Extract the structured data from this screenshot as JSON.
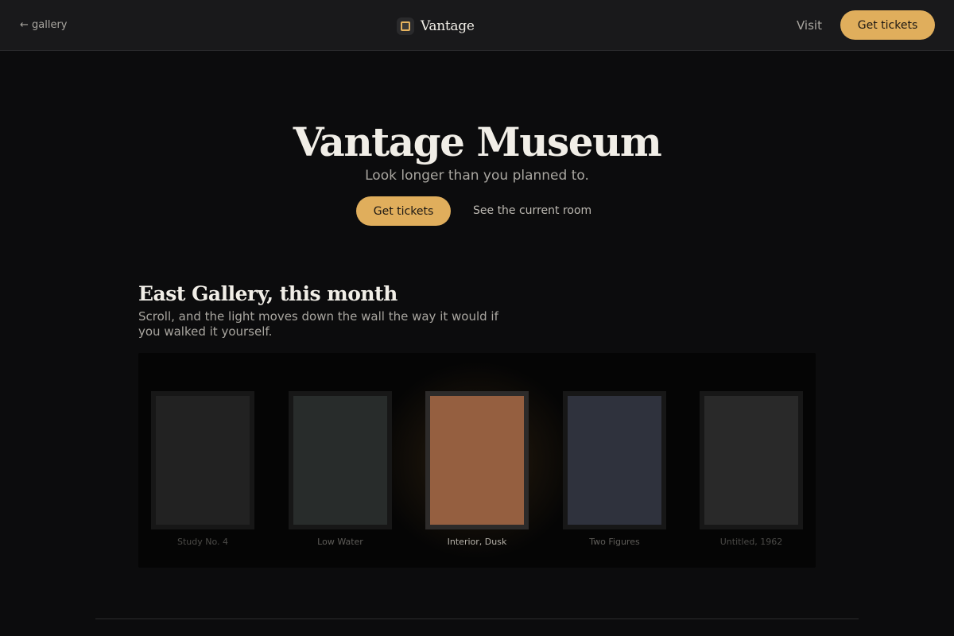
{
  "header": {
    "back_label": "← gallery",
    "brand": "Vantage",
    "brand_icon": "framed-painting-icon",
    "nav_visit": "Visit",
    "tickets_label": "Get tickets"
  },
  "hero": {
    "title": "Vantage Museum",
    "subtitle": "Look longer than you planned to.",
    "tickets_label": "Get tickets",
    "room_link": "See the current room"
  },
  "section": {
    "title": "East Gallery, this month",
    "description": "Scroll, and the light moves down the wall the way it would if you walked it yourself."
  },
  "gallery": {
    "artworks": [
      {
        "title": "Study No. 4",
        "color": "#222222",
        "state": "dark"
      },
      {
        "title": "Low Water",
        "color": "#282c2b",
        "state": "dim"
      },
      {
        "title": "Interior, Dusk",
        "color": "#955f40",
        "state": "lit"
      },
      {
        "title": "Two Figures",
        "color": "#2f323d",
        "state": "dim"
      },
      {
        "title": "Untitled, 1962",
        "color": "#292929",
        "state": "dark"
      }
    ]
  },
  "colors": {
    "accent": "#e0ae5c",
    "background": "#0c0c0d",
    "header": "#19191b"
  }
}
